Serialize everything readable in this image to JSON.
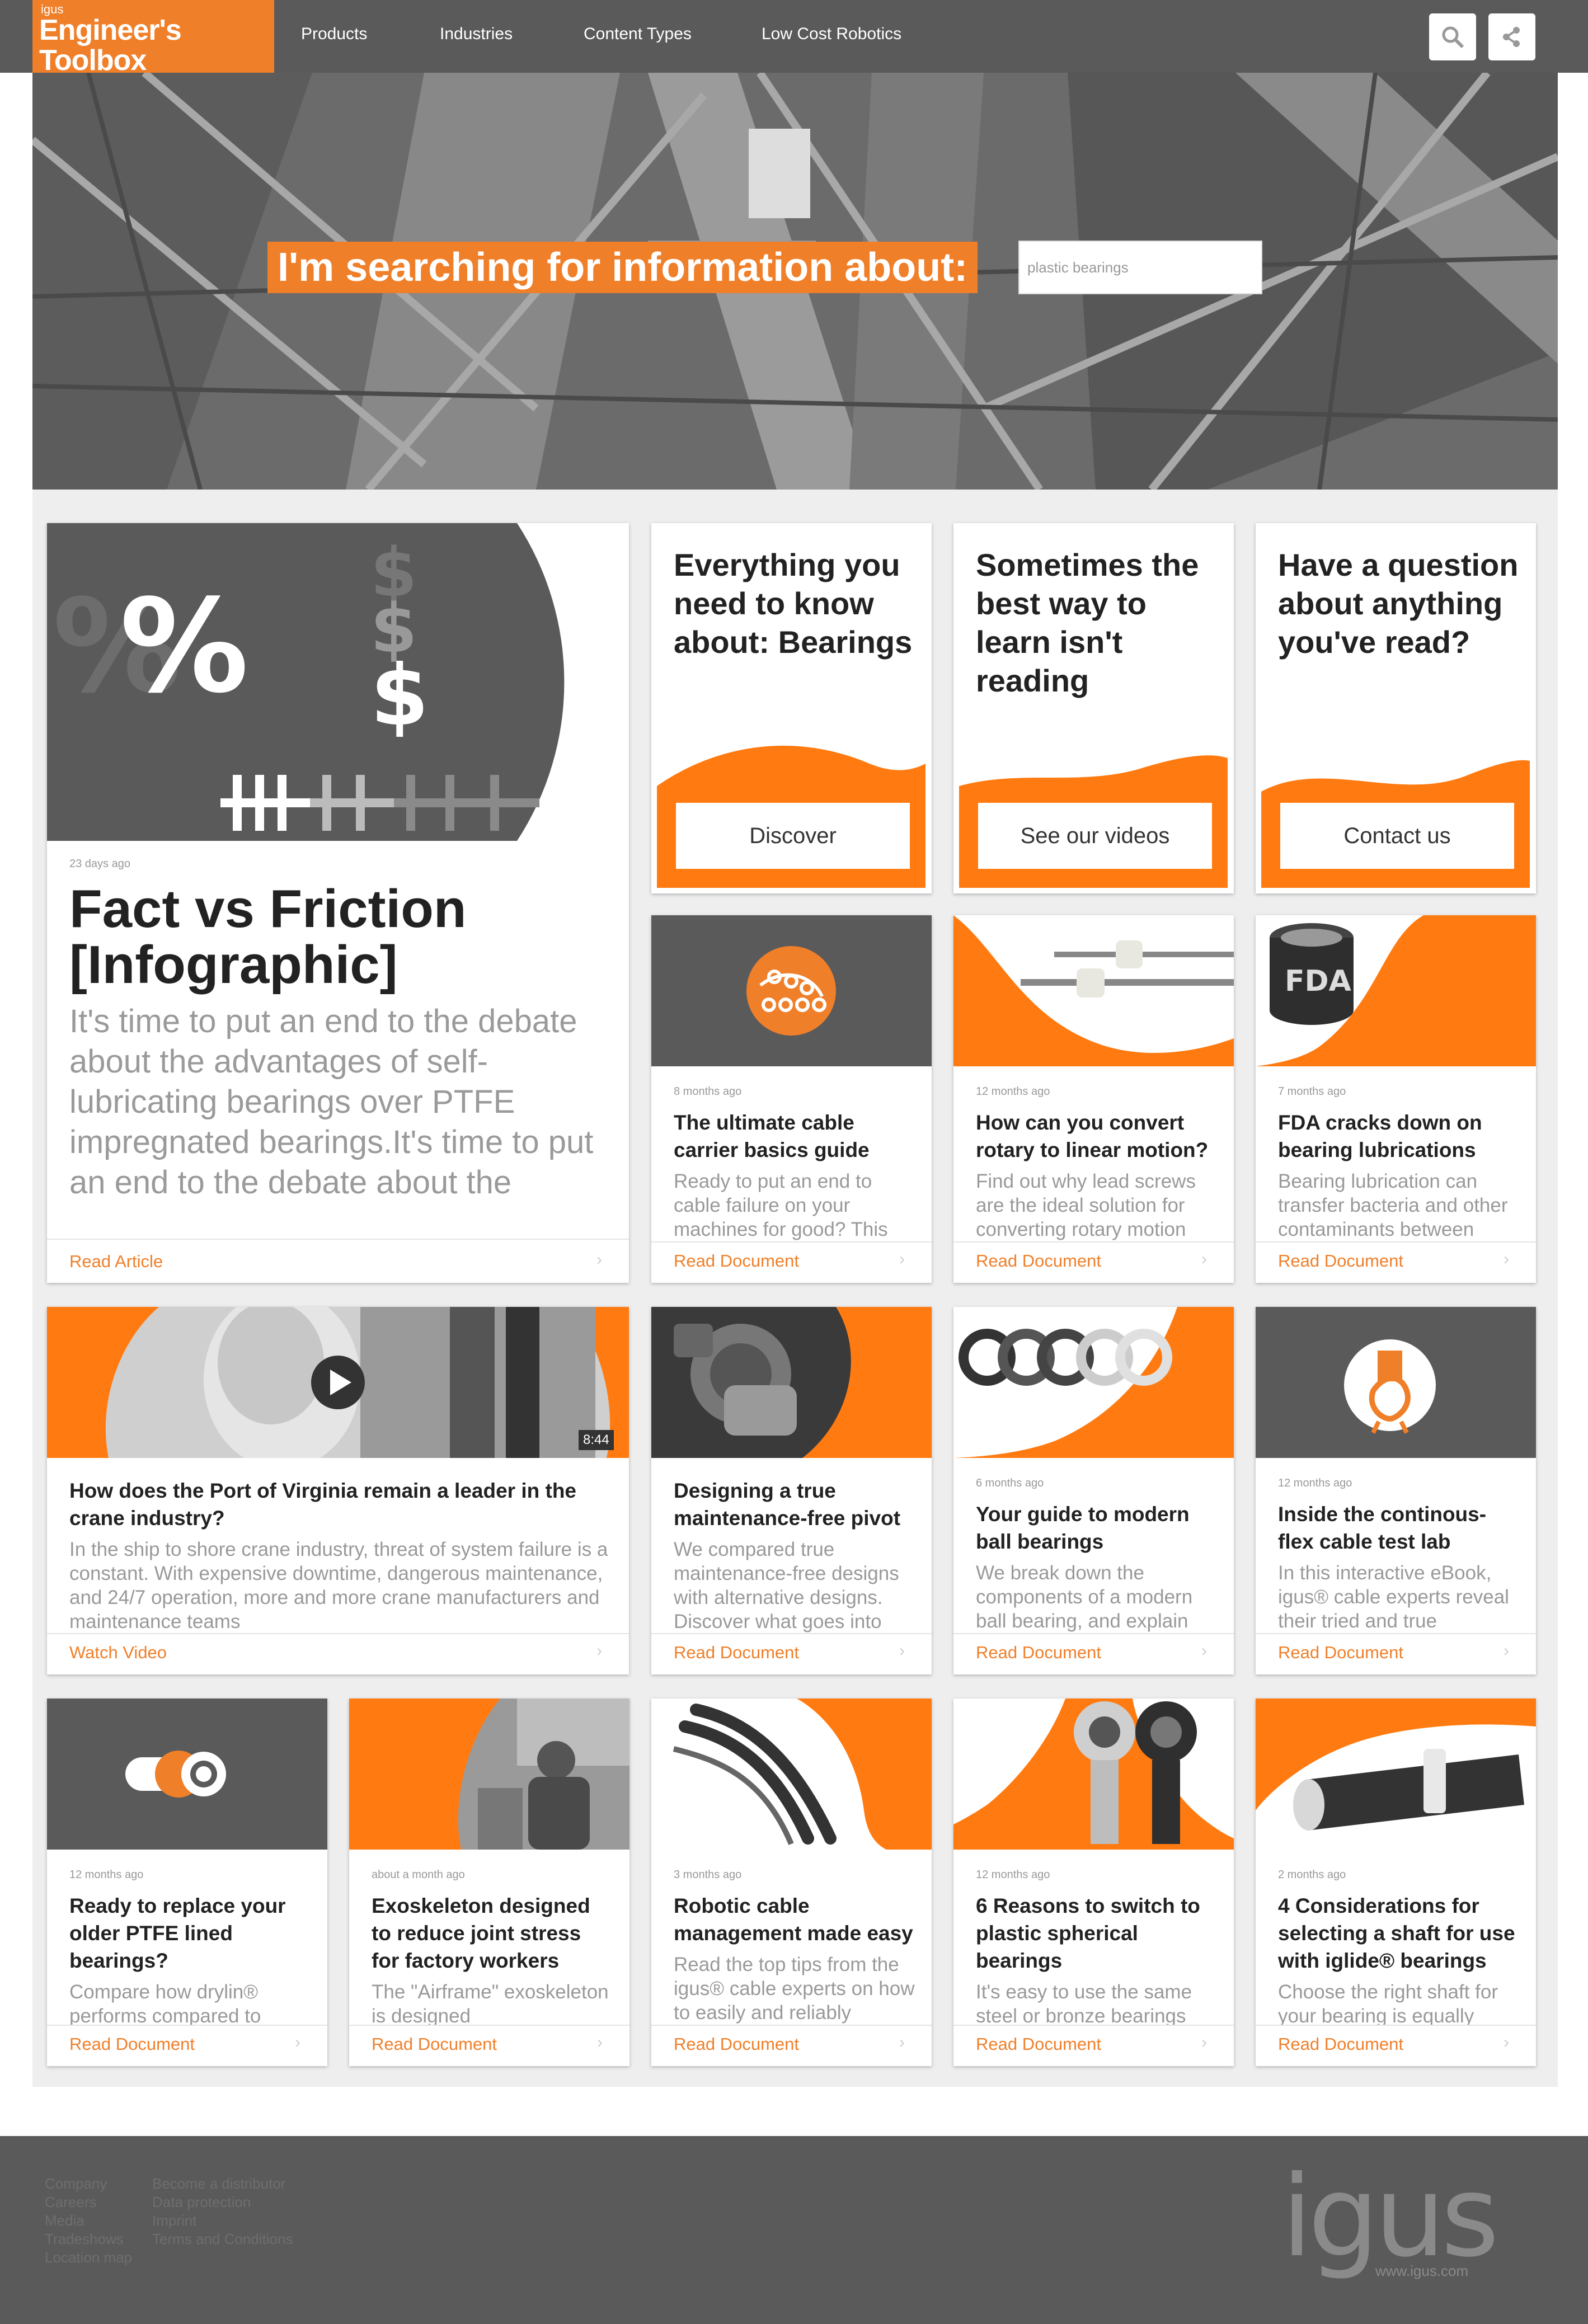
{
  "header": {
    "brand": "igus",
    "logo_line1": "Engineer's",
    "logo_line2": "Toolbox",
    "nav": [
      "Products",
      "Industries",
      "Content Types",
      "Low Cost Robotics"
    ],
    "search_icon": "search-icon",
    "share_icon": "share-icon"
  },
  "hero": {
    "title": "I'm searching for information about:",
    "search_placeholder": "plastic bearings"
  },
  "featured": {
    "age": "23 days ago",
    "title_line1": "Fact vs Friction",
    "title_line2": "[Infographic]",
    "description": "It's time to put an end to the debate about the advantages of self-lubricating bearings over PTFE impregnated bearings.It's time to put an end to the debate about the advantages of self-lubricating be",
    "link": "Read Article"
  },
  "promos": [
    {
      "title": "Everything you need to know about: Bearings",
      "button": "Discover"
    },
    {
      "title": "Sometimes the best way to learn isn't reading",
      "button": "See our videos"
    },
    {
      "title": "Have a question about anything you've read?",
      "button": "Contact us"
    }
  ],
  "cards_row2": [
    {
      "age": "8 months ago",
      "title": "The ultimate cable carrier basics guide",
      "description": "Ready to put an end to cable failure on your machines for good? This",
      "link": "Read Document"
    },
    {
      "age": "12 months ago",
      "title": "How can you convert rotary to linear motion?",
      "description": "Find out why lead screws are the ideal solution for converting rotary motion",
      "link": "Read Document"
    },
    {
      "age": "7 months ago",
      "title": "FDA cracks down on bearing lubrications",
      "description": "Bearing lubrication can transfer bacteria and other contaminants between",
      "link": "Read Document"
    }
  ],
  "video_card": {
    "duration": "8:44",
    "title": "How does the Port of Virginia remain a leader in the crane industry?",
    "description": "In the ship to shore crane industry, threat of system failure is a constant. With expensive downtime, dangerous maintenance, and 24/7 operation, more and more crane manufacturers and maintenance teams",
    "link": "Watch Video"
  },
  "cards_row3": [
    {
      "age": "",
      "title": "Designing a true maintenance-free pivot",
      "description": "We compared true maintenance-free designs with alternative designs. Discover what goes into",
      "link": "Read Document"
    },
    {
      "age": "6 months ago",
      "title": "Your guide to modern ball bearings",
      "description": "We break down the components of a modern ball bearing, and explain",
      "link": "Read Document"
    },
    {
      "age": "12 months ago",
      "title": "Inside the continous-flex cable test lab",
      "description": "In this interactive eBook, igus® cable experts reveal their tried and true",
      "link": "Read Document"
    }
  ],
  "cards_row4": [
    {
      "age": "12 months ago",
      "title": "Ready to replace your older PTFE lined bearings?",
      "description": "Compare how drylin® performs compared to",
      "link": "Read Document"
    },
    {
      "age": "about a month ago",
      "title": "Exoskeleton designed to reduce joint stress for factory workers",
      "description": "The \"Airframe\" exoskeleton is designed",
      "link": "Read Document"
    },
    {
      "age": "3 months ago",
      "title": "Robotic cable management made easy",
      "description": "Read the top tips from the igus® cable experts on how to easily and reliably",
      "link": "Read Document"
    },
    {
      "age": "12 months ago",
      "title": "6 Reasons to switch to plastic spherical bearings",
      "description": "It's easy to use the same steel or bronze bearings",
      "link": "Read Document"
    },
    {
      "age": "2 months ago",
      "title": "4 Considerations for selecting a shaft for use with iglide® bearings",
      "description": "Choose the right shaft for your bearing is equally",
      "link": "Read Document"
    }
  ],
  "footer": {
    "col1": [
      "Company",
      "Careers",
      "Media",
      "Tradeshows",
      "Location map"
    ],
    "col2": [
      "Become a distributor",
      "Data protection",
      "Imprint",
      "Terms and Conditions"
    ],
    "logo": "igus",
    "url": "www.igus.com"
  },
  "colors": {
    "accent": "#f07f2a",
    "header_bg": "#5a5a5a",
    "page_bg": "#eeeeee"
  }
}
